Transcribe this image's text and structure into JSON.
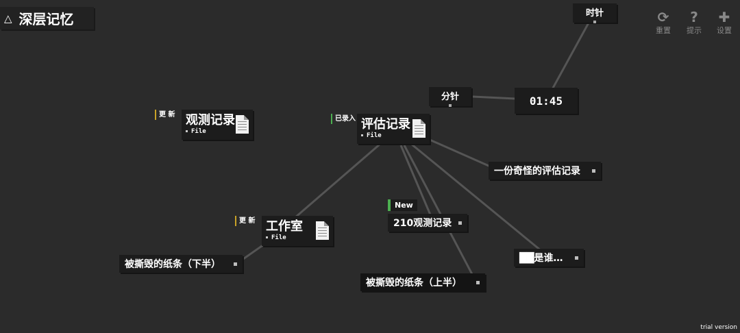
{
  "header": {
    "triangle_icon": "△",
    "title": "深层记忆"
  },
  "toolbar": {
    "reset": {
      "icon": "⟳",
      "label": "重置"
    },
    "hint": {
      "icon": "?",
      "label": "提示"
    },
    "settings": {
      "icon": "✚",
      "label": "设置"
    }
  },
  "nodes": {
    "hour_hand": {
      "label": "时针"
    },
    "minute_hand": {
      "label": "分针"
    },
    "clock": {
      "time": "01:45"
    },
    "observation_record": {
      "tag": "更 新",
      "name": "观测记录",
      "type": "File"
    },
    "assessment_record": {
      "tag": "已录入",
      "name": "评估记录",
      "type": "File"
    },
    "studio": {
      "tag": "更 新",
      "name": "工作室",
      "type": "File"
    },
    "strange_assessment": {
      "label": "一份奇怪的评估记录"
    },
    "record_210": {
      "tag": "New",
      "label": "210观测记录"
    },
    "who_is": {
      "label": "██是谁…"
    },
    "torn_note_lower": {
      "label": "被撕毁的纸条（下半）"
    },
    "torn_note_upper": {
      "label": "被撕毁的纸条（上半）"
    }
  },
  "footer": {
    "watermark": "trial version"
  },
  "colors": {
    "background": "#2b2b2b",
    "node": "#1c1c1c",
    "line": "#555555",
    "new_tag": "#4caf50",
    "update_tag": "#c9a227"
  }
}
